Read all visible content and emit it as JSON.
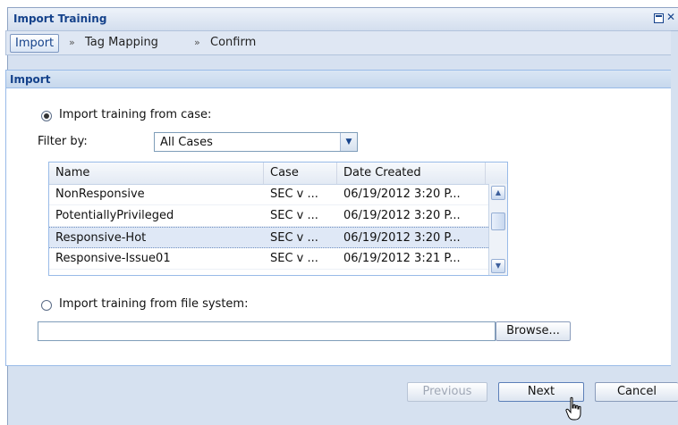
{
  "window": {
    "title": "Import Training"
  },
  "wizard": {
    "steps": [
      "Import",
      "Tag Mapping",
      "Confirm"
    ],
    "separator": "»"
  },
  "panel": {
    "title": "Import",
    "option_case": "Import training from case:",
    "filter_label": "Filter by:",
    "filter_value": "All Cases",
    "grid": {
      "columns": [
        "Name",
        "Case",
        "Date Created"
      ],
      "rows": [
        [
          "NonResponsive",
          "SEC v ...",
          "06/19/2012 3:20 P..."
        ],
        [
          "PotentiallyPrivileged",
          "SEC v ...",
          "06/19/2012 3:20 P..."
        ],
        [
          "Responsive-Hot",
          "SEC v ...",
          "06/19/2012 3:20 P..."
        ],
        [
          "Responsive-Issue01",
          "SEC v ...",
          "06/19/2012 3:21 P..."
        ]
      ]
    },
    "option_file": "Import training from file system:",
    "file_value": "",
    "browse_label": "Browse..."
  },
  "footer": {
    "previous_label": "Previous",
    "next_label": "Next",
    "cancel_label": "Cancel"
  }
}
